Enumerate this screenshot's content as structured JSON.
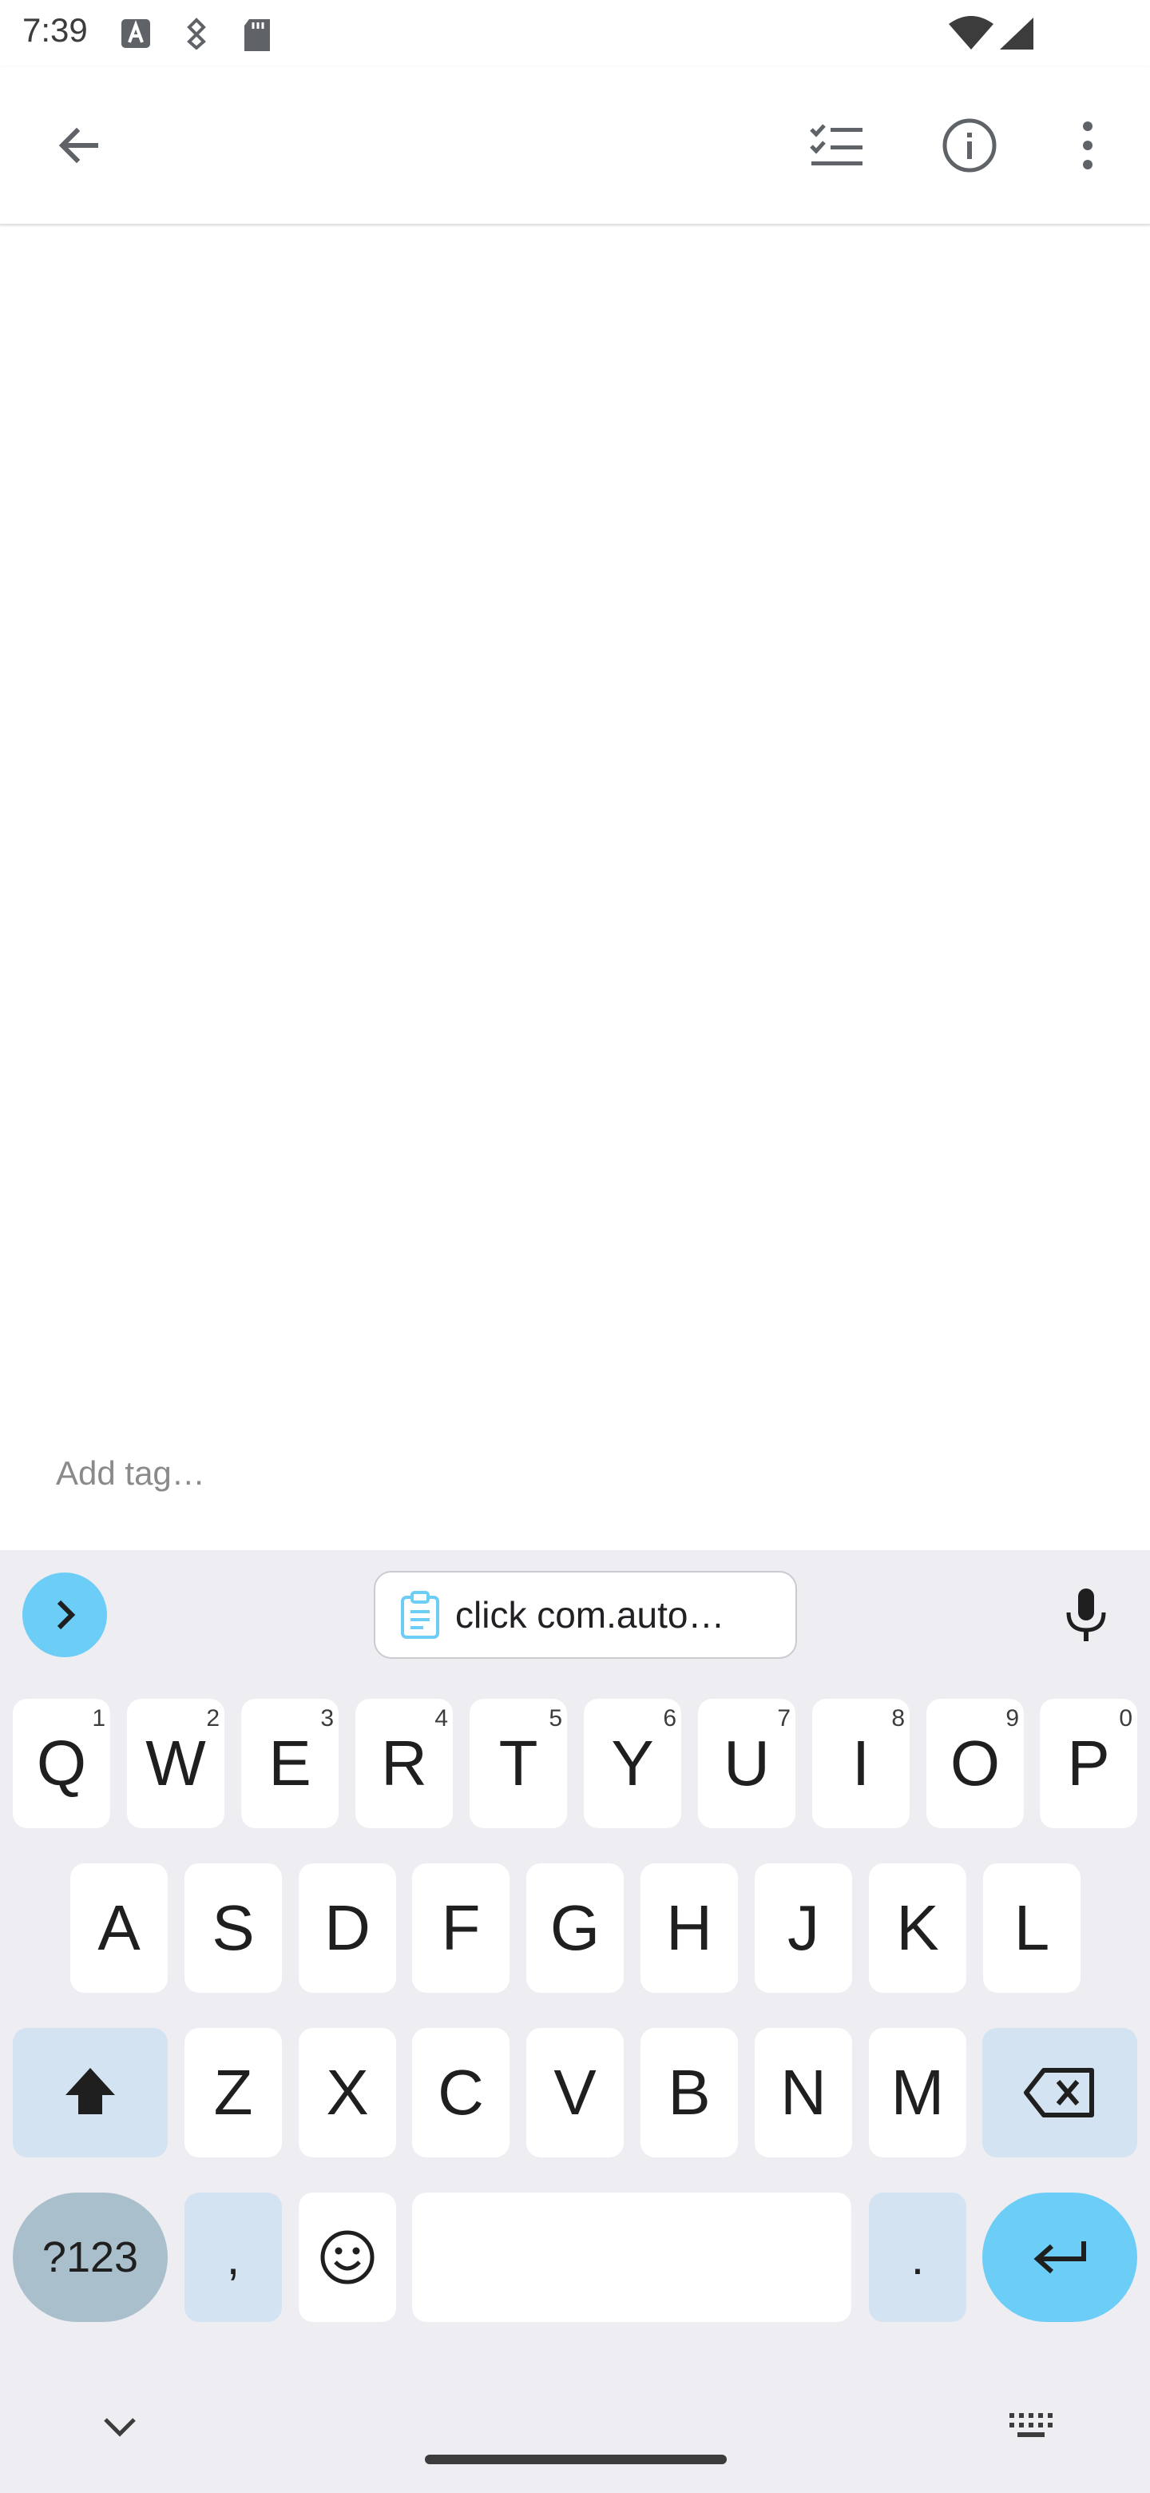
{
  "status_bar": {
    "time": "7:39"
  },
  "note": {
    "tag_placeholder": "Add tag…"
  },
  "keyboard": {
    "clipboard_text": "click com.auto…",
    "row1": [
      {
        "label": "Q",
        "hint": "1"
      },
      {
        "label": "W",
        "hint": "2"
      },
      {
        "label": "E",
        "hint": "3"
      },
      {
        "label": "R",
        "hint": "4"
      },
      {
        "label": "T",
        "hint": "5"
      },
      {
        "label": "Y",
        "hint": "6"
      },
      {
        "label": "U",
        "hint": "7"
      },
      {
        "label": "I",
        "hint": "8"
      },
      {
        "label": "O",
        "hint": "9"
      },
      {
        "label": "P",
        "hint": "0"
      }
    ],
    "row2": [
      "A",
      "S",
      "D",
      "F",
      "G",
      "H",
      "J",
      "K",
      "L"
    ],
    "row3": [
      "Z",
      "X",
      "C",
      "V",
      "B",
      "N",
      "M"
    ],
    "symbols_label": "?123",
    "comma_label": ",",
    "period_label": "."
  }
}
